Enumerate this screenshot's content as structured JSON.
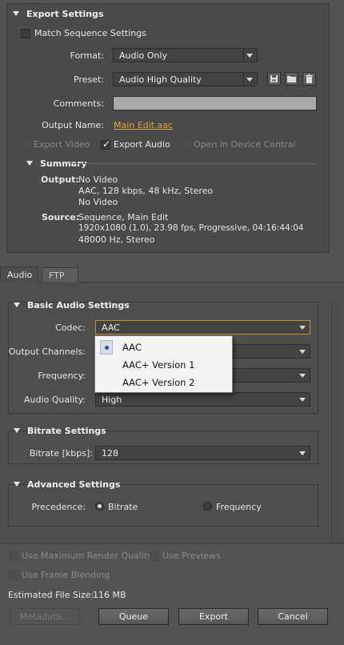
{
  "export_settings": {
    "title": "Export Settings",
    "match_sequence_label": "Match Sequence Settings",
    "format_label": "Format:",
    "format_value": "Audio Only",
    "preset_label": "Preset:",
    "preset_value": "Audio High Quality",
    "comments_label": "Comments:",
    "comments_value": "",
    "output_name_label": "Output Name:",
    "output_name_value": "Main Edit.aac",
    "export_video_label": "Export Video",
    "export_audio_label": "Export Audio",
    "open_device_central_label": "Open in Device Central"
  },
  "summary": {
    "title": "Summary",
    "output_label": "Output:",
    "output_lines": [
      "No Video",
      "AAC, 128 kbps, 48 kHz, Stereo",
      "No Video"
    ],
    "source_label": "Source:",
    "source_lines": [
      "Sequence, Main Edit",
      "1920x1080 (1.0), 23.98 fps, Progressive, 04:16:44:04",
      "48000 Hz, Stereo"
    ]
  },
  "tabs": [
    {
      "label": "Audio",
      "active": true
    },
    {
      "label": "FTP",
      "active": false
    }
  ],
  "basic_audio": {
    "title": "Basic Audio Settings",
    "codec_label": "Codec:",
    "codec_value": "AAC",
    "output_channels_label": "Output Channels:",
    "frequency_label": "Frequency:",
    "audio_quality_label": "Audio Quality:",
    "audio_quality_value": "High"
  },
  "codec_dropdown": {
    "options": [
      "AAC",
      "AAC+ Version 1",
      "AAC+ Version 2"
    ],
    "selected": "AAC"
  },
  "bitrate": {
    "title": "Bitrate Settings",
    "label": "Bitrate [kbps]:",
    "value": "128"
  },
  "advanced": {
    "title": "Advanced Settings",
    "precedence_label": "Precedence:",
    "option_bitrate": "Bitrate",
    "option_frequency": "Frequency"
  },
  "bottom": {
    "max_render_label": "Use Maximum Render Quality",
    "use_previews_label": "Use Previews",
    "frame_blending_label": "Use Frame Blending",
    "file_size_label": "Estimated File Size:",
    "file_size_value": "116 MB",
    "metadata_label": "Metadata...",
    "queue_label": "Queue",
    "export_label": "Export",
    "cancel_label": "Cancel"
  },
  "colors": {
    "accent_link": "#e0a23a",
    "focus_border": "#c8902a",
    "background": "#535353"
  }
}
